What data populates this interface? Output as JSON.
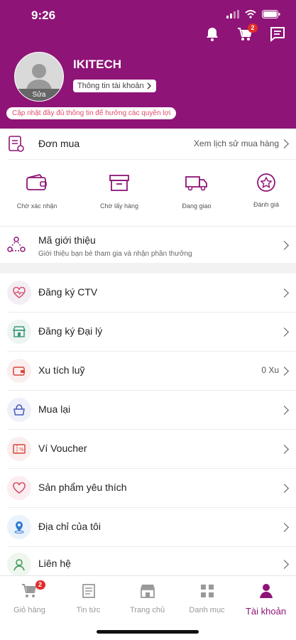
{
  "status_bar": {
    "time": "9:26"
  },
  "header": {
    "cart_badge": "2",
    "username": "IKITECH",
    "avatar_edit_label": "Sửa",
    "account_info_label": "Thông tin tài khoản",
    "notice": "Cập nhật đầy đủ thông tin để hưởng các quyền lợi"
  },
  "orders": {
    "title": "Đơn mua",
    "history_link": "Xem lịch sử mua hàng",
    "statuses": [
      {
        "label": "Chờ xác nhận",
        "icon": "wallet-icon"
      },
      {
        "label": "Chờ lấy hàng",
        "icon": "box-icon"
      },
      {
        "label": "Đang giao",
        "icon": "truck-icon"
      },
      {
        "label": "Đánh giá",
        "icon": "star-icon"
      }
    ]
  },
  "referral": {
    "title": "Mã giới thiệu",
    "subtitle": "Giới thiệu bạn bè tham gia và nhận phần thưởng"
  },
  "menu": [
    {
      "label": "Đăng ký CTV",
      "value": "",
      "icon": "heart-pulse-icon"
    },
    {
      "label": "Đăng ký Đại lý",
      "value": "",
      "icon": "store-icon"
    },
    {
      "label": "Xu tích luỹ",
      "value": "0 Xu",
      "icon": "coin-wallet-icon"
    },
    {
      "label": "Mua lại",
      "value": "",
      "icon": "bag-icon"
    },
    {
      "label": "Ví Voucher",
      "value": "",
      "icon": "voucher-icon"
    },
    {
      "label": "Sản phẩm yêu thích",
      "value": "",
      "icon": "heart-icon"
    },
    {
      "label": "Địa chỉ của tôi",
      "value": "",
      "icon": "location-icon"
    },
    {
      "label": "Liên hệ",
      "value": "",
      "icon": "contact-icon"
    }
  ],
  "tabbar": {
    "cart_badge": "2",
    "tabs": [
      {
        "label": "Giỏ hàng",
        "icon": "cart-icon"
      },
      {
        "label": "Tin tức",
        "icon": "news-icon"
      },
      {
        "label": "Trang chủ",
        "icon": "shop-icon"
      },
      {
        "label": "Danh mục",
        "icon": "grid-icon"
      },
      {
        "label": "Tài khoản",
        "icon": "user-icon"
      }
    ]
  },
  "colors": {
    "brand": "#8e1477",
    "badge": "#e32b2b",
    "notice": "#e04a6a"
  }
}
